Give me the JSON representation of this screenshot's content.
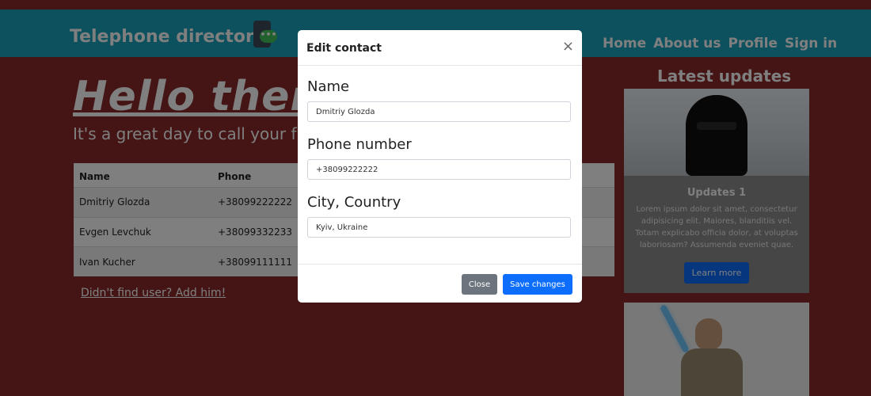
{
  "nav": {
    "brand": "Telephone directory",
    "brand_icon": "chat-bubble-phone-icon",
    "links": [
      "Home",
      "About us",
      "Profile",
      "Sign in"
    ]
  },
  "hero": {
    "title_visible": "Hello there",
    "title_tail": ")!",
    "subtitle": "It's a great day to call your frien"
  },
  "table": {
    "headers": [
      "Name",
      "Phone"
    ],
    "rows": [
      [
        "Dmitriy Glozda",
        "+38099222222"
      ],
      [
        "Evgen Levchuk",
        "+38099332233"
      ],
      [
        "Ivan Kucher",
        "+38099111111"
      ]
    ]
  },
  "add_link": "Didn't find user? Add him!",
  "sidebar": {
    "title": "Latest updates",
    "card1": {
      "title": "Updates 1",
      "text": "Lorem ipsum dolor sit amet, consectetur adipisicing elit. Maiores, blanditiis vel. Totam explicabo officia dolor, at voluptas laboriosam? Assumenda eveniet quae.",
      "button": "Learn more"
    }
  },
  "modal": {
    "title": "Edit contact",
    "close_icon": "×",
    "name_label": "Name",
    "name_value": "Dmitriy Glozda",
    "phone_label": "Phone number",
    "phone_value": "+38099222222",
    "city_label": "City, Country",
    "city_value": "Kyiv, Ukraine",
    "close_button": "Close",
    "save_button": "Save changes"
  },
  "colors": {
    "navbar": "#1aa3bd",
    "page_bg": "#8b2b2b",
    "primary": "#0d6efd",
    "secondary": "#6c757d"
  }
}
